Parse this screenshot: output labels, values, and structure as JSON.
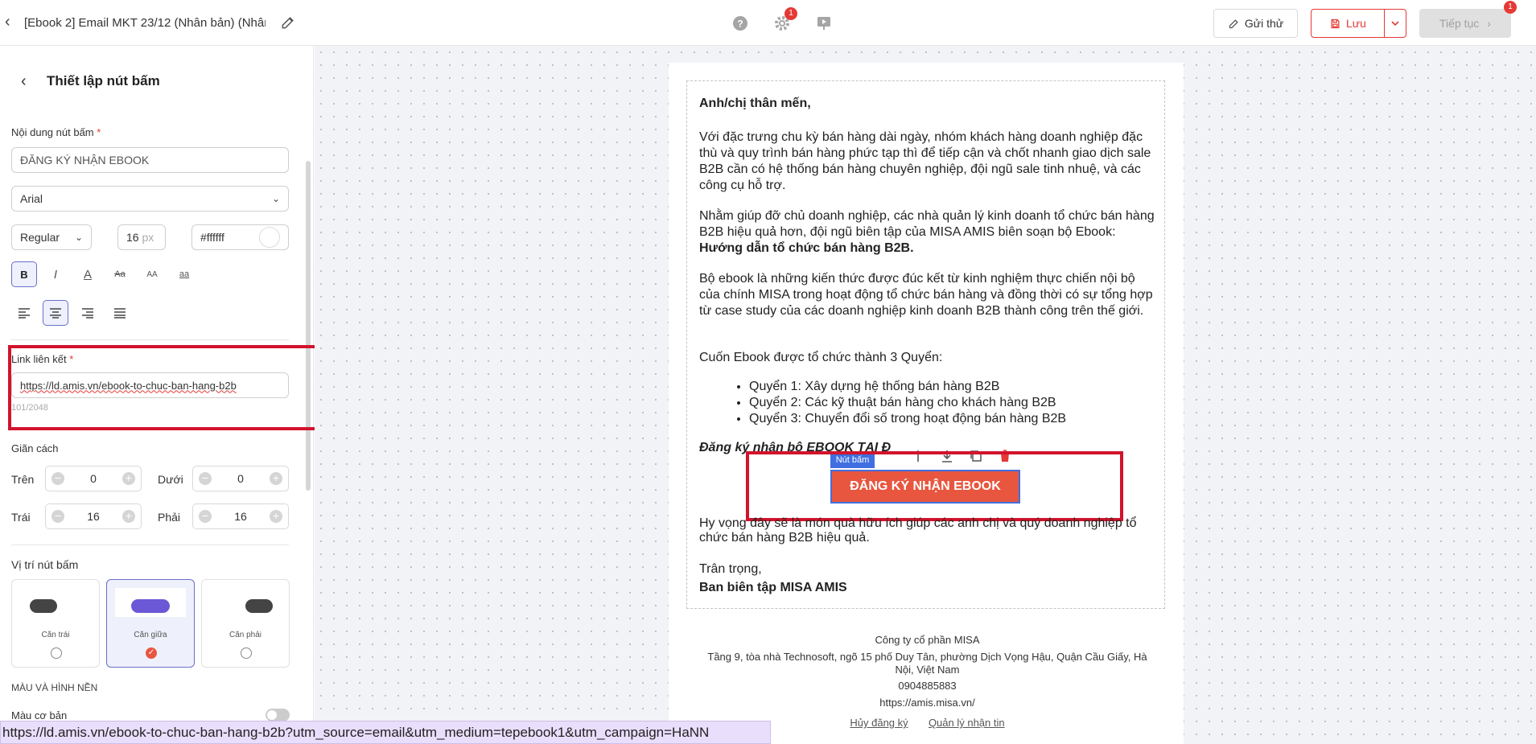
{
  "topbar": {
    "title": "[Ebook 2] Email MKT 23/12 (Nhân bản) (Nhân b...",
    "settings_badge": "1",
    "next_badge": "1",
    "send_test_label": "Gửi thử",
    "save_label": "Lưu",
    "next_label": "Tiếp tục"
  },
  "panel": {
    "title": "Thiết lập nút bấm",
    "content_label": "Nội dung nút bấm",
    "required_mark": "*",
    "content_value": "ĐĂNG KÝ NHẬN EBOOK",
    "font_family": "Arial",
    "font_weight": "Regular",
    "font_size": "16",
    "font_size_unit": "px",
    "text_color": "#ffffff",
    "format_buttons": {
      "bold": "B",
      "italic": "I",
      "color": "A",
      "strike": "Aa",
      "upper": "AA",
      "lower": "aa"
    },
    "link_label": "Link liên kết",
    "link_value": "https://ld.amis.vn/ebook-to-chuc-ban-hang-b2b",
    "link_counter": "101/2048",
    "spacing_label": "Giãn cách",
    "spacing": {
      "top_label": "Trên",
      "top": "0",
      "bottom_label": "Dưới",
      "bottom": "0",
      "left_label": "Trái",
      "left": "16",
      "right_label": "Phải",
      "right": "16"
    },
    "position_label": "Vị trí nút bấm",
    "positions": {
      "left": "Căn trái",
      "center": "Căn giữa",
      "right": "Căn phải"
    },
    "color_section_label": "MÀU VÀ HÌNH NỀN",
    "basic_color_label": "Màu cơ bản"
  },
  "email": {
    "greeting": "Anh/chị thân mến,",
    "p1": "Với đặc trưng chu kỳ bán hàng dài ngày, nhóm khách hàng doanh nghiệp đặc thù và quy trình bán hàng phức tạp thì để tiếp cận và chốt nhanh giao dịch sale B2B cần có hệ thống bán hàng chuyên nghiệp, đội ngũ sale tinh nhuệ, và các công cụ hỗ trợ.",
    "p2_start": "Nhằm giúp đỡ chủ doanh nghiệp, các nhà quản lý kinh doanh tổ chức bán hàng B2B hiệu quả hơn, đội ngũ biên tập của MISA AMIS biên soạn bộ Ebook: ",
    "p2_bold": "Hướng dẫn tổ chức bán hàng B2B.",
    "p3": "Bộ ebook là những kiến thức được đúc kết từ kinh nghiệm thực chiến nội bộ của chính MISA trong hoạt động tổ chức bán hàng và đồng thời có sự tổng hợp từ case study của các doanh nghiệp kinh doanh B2B thành công trên thế giới.",
    "p4": "Cuốn Ebook được tổ chức thành 3 Quyển:",
    "list": [
      "Quyển 1: Xây dựng hệ thống bán hàng B2B",
      "Quyển 2: Các kỹ thuật bán hàng cho khách hàng B2B",
      "Quyển 3: Chuyển đổi số trong hoạt động bán hàng B2B"
    ],
    "cta_heading": "Đăng ký nhận bộ EBOOK TẠI Đ",
    "button_tag": "Nút bấm",
    "button_label": "ĐĂNG KÝ NHẬN EBOOK",
    "p5": "Hy vọng đây sẽ là món quà hữu ích giúp các anh chị và quý doanh nghiệp tổ chức bán hàng B2B hiệu quả.",
    "regards": "Trân trọng,",
    "signature": "Ban biên tập MISA AMIS",
    "footer": {
      "company": "Công ty cổ phần MISA",
      "address": "Tầng 9, tòa nhà Technosoft, ngõ 15 phố Duy Tân, phường Dịch Vọng Hậu, Quận Cầu Giấy, Hà Nội, Việt Nam",
      "phone": "0904885883",
      "website": "https://amis.misa.vn/",
      "unsubscribe": "Hủy đăng ký",
      "manage": "Quản lý nhận tin"
    }
  },
  "status_url": "https://ld.amis.vn/ebook-to-chuc-ban-hang-b2b?utm_source=email&utm_medium=tepebook1&utm_campaign=HaNN",
  "colors": {
    "accent": "#e8563f",
    "selection": "#3f6fe0",
    "highlight_box": "#d3132c",
    "active_option": "#6b6fc9"
  }
}
